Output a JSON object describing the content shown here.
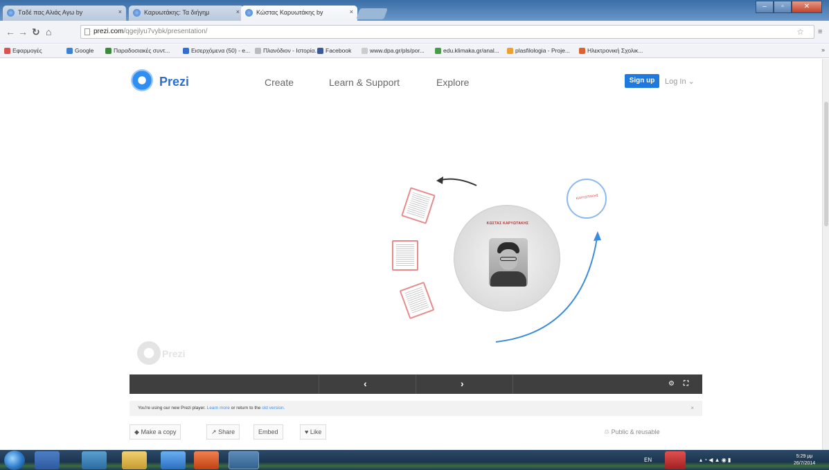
{
  "browser": {
    "tabs": [
      {
        "title": "Tαδέ πας Αλιάς Αγω by"
      },
      {
        "title": "Καρυωτάκης: Τα διήγημ"
      },
      {
        "title": "Κώστας Καρυωτάκης by"
      }
    ],
    "url_host": "prezi.com",
    "url_path": "/qgejlyu7vybk/presentation/",
    "bookmarks": [
      "Εφαρμογές",
      "Google",
      "Παραδοσιακές συντ...",
      "Εισερχόμενα (50) - e...",
      "Πλανόδιον - Ιστορία...",
      "Facebook",
      "www.dpa.gr/pls/por...",
      "edu.klimaka.gr/anal...",
      "plasfilologia - Proje...",
      "Ηλεκτρονική Σχολικ..."
    ]
  },
  "header": {
    "logo_text": "Prezi",
    "nav": [
      "Create",
      "Learn & Support",
      "Explore"
    ],
    "signup_label": "Sign up",
    "login_label": "Log In ⌄"
  },
  "presentation": {
    "circle_title": "ΚΩΣΤΑΣ ΚΑΡΥΩΤΑΚΗΣ",
    "side_label": "ΚΑΡΥΩΤΑΚΗΣ",
    "watermark": "Prezi"
  },
  "player": {
    "prev": "‹",
    "next": "›",
    "settings_icon": "gear",
    "fullscreen_icon": "fullscreen"
  },
  "notice": {
    "text_before": "You're using our new Prezi player.",
    "learn_more": "Learn more",
    "text_mid": "or return to the",
    "old_version": "old version.",
    "close": "×"
  },
  "actions": {
    "copy": "Make a copy",
    "share": "Share",
    "embed": "Embed",
    "like": "Like",
    "public": "Public & reusable"
  },
  "taskbar": {
    "lang": "EN",
    "time": "5:29 μμ",
    "date": "26/7/2014"
  }
}
